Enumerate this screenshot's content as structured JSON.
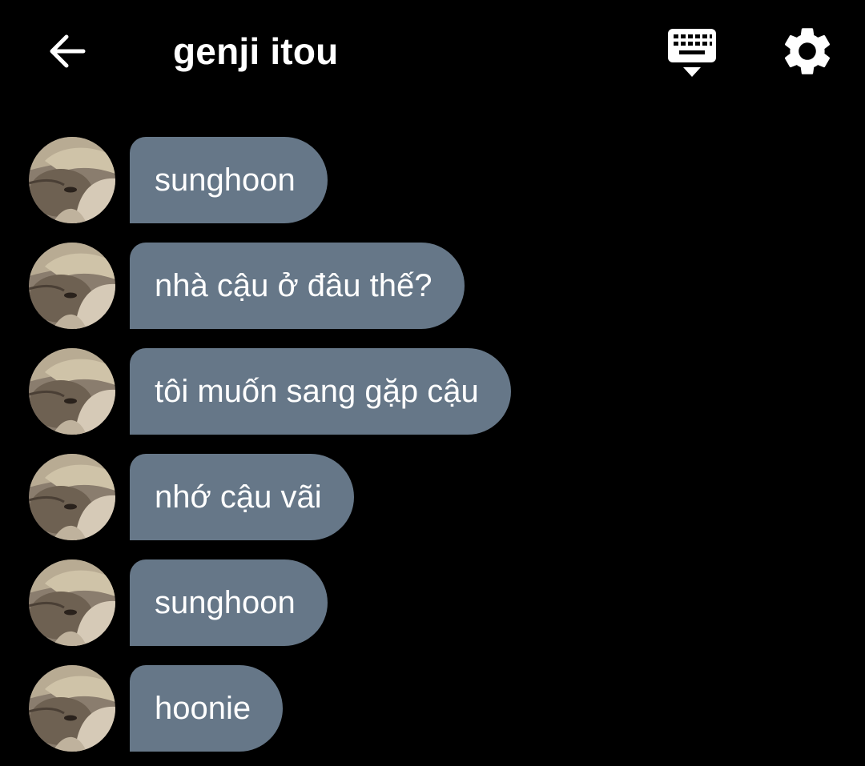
{
  "header": {
    "title": "genji itou",
    "back_icon": "arrow-left-icon",
    "keyboard_icon": "keyboard-hide-icon",
    "settings_icon": "gear-icon"
  },
  "colors": {
    "background": "#000000",
    "bubble": "#667788",
    "text": "#ffffff"
  },
  "messages": [
    {
      "text": "sunghoon"
    },
    {
      "text": "nhà cậu ở đâu thế?"
    },
    {
      "text": "tôi muốn sang gặp cậu"
    },
    {
      "text": "nhớ cậu vãi"
    },
    {
      "text": "sunghoon"
    },
    {
      "text": "hoonie"
    }
  ]
}
